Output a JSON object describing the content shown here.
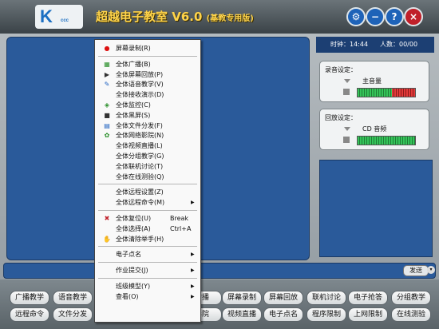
{
  "app": {
    "logo_sub": "ccc",
    "title": "超越电子教室",
    "version": "V6.0",
    "edition": "(基教专用版)"
  },
  "window_buttons": [
    {
      "name": "settings",
      "glyph": "⚙",
      "color": "#1e63b8"
    },
    {
      "name": "minimize",
      "glyph": "−",
      "color": "#1e63b8"
    },
    {
      "name": "help",
      "glyph": "?",
      "color": "#1e63b8"
    },
    {
      "name": "close",
      "glyph": "×",
      "color": "#c0202a"
    }
  ],
  "status": {
    "clock_label": "时钟：",
    "clock_value": "14:44",
    "people_label": "人数：",
    "people_value": "00/00"
  },
  "recording": {
    "label": "录音设定：",
    "source": "主音量",
    "level_green_pct": 0.6,
    "level_red_pct": 0.4
  },
  "playback": {
    "label": "回放设定：",
    "source": "CD 音频",
    "level_green_pct": 1.0
  },
  "chat": {
    "send_label": "发送",
    "send_arrow": "▾"
  },
  "toolbar": {
    "row1": [
      "广播教学",
      "语音教学",
      "",
      "",
      "转播",
      "屏幕录制",
      "屏幕回放",
      "联机讨论",
      "电子抢答",
      "分组教学"
    ],
    "row2": [
      "远程命令",
      "文件分发",
      "",
      "",
      "影院",
      "视频直播",
      "电子点名",
      "程序限制",
      "上网限制",
      "在线测验"
    ]
  },
  "menu": [
    {
      "type": "item",
      "label": "屏幕录制(R)",
      "icon": "●",
      "icon_color": "#d11"
    },
    {
      "type": "sep"
    },
    {
      "type": "item",
      "label": "全体广播(B)",
      "icon": "▦",
      "icon_color": "#2a8f2a"
    },
    {
      "type": "item",
      "label": "全体屏幕回放(P)",
      "icon": "▶",
      "icon_color": "#333"
    },
    {
      "type": "item",
      "label": "全体语音教学(V)",
      "icon": "✎",
      "icon_color": "#1b5fbf"
    },
    {
      "type": "item",
      "label": "全体接收演示(D)",
      "icon": "",
      "icon_color": "#333"
    },
    {
      "type": "item",
      "label": "全体监控(C)",
      "icon": "◈",
      "icon_color": "#2a8f2a"
    },
    {
      "type": "item",
      "label": "全体黑屏(S)",
      "icon": "■",
      "icon_color": "#333"
    },
    {
      "type": "item",
      "label": "全体文件分发(F)",
      "icon": "▤",
      "icon_color": "#1b5fbf"
    },
    {
      "type": "item",
      "label": "全体网络影院(N)",
      "icon": "✿",
      "icon_color": "#2a8f2a"
    },
    {
      "type": "item",
      "label": "全体视频直播(L)",
      "icon": "",
      "icon_color": "#333"
    },
    {
      "type": "item",
      "label": "全体分组教学(G)",
      "icon": "",
      "icon_color": "#333"
    },
    {
      "type": "item",
      "label": "全体联机讨论(T)",
      "icon": "",
      "icon_color": "#333"
    },
    {
      "type": "item",
      "label": "全体在线测验(Q)",
      "icon": "",
      "icon_color": "#333"
    },
    {
      "type": "sep"
    },
    {
      "type": "item",
      "label": "全体远程设置(Z)",
      "icon": "",
      "icon_color": "#333"
    },
    {
      "type": "item",
      "label": "全体远程命令(M)",
      "icon": "",
      "icon_color": "#333",
      "submenu": true
    },
    {
      "type": "sep"
    },
    {
      "type": "item",
      "label": "全体复位(U)",
      "shortcut": "Break",
      "icon": "✖",
      "icon_color": "#c0202a"
    },
    {
      "type": "item",
      "label": "全体选择(A)",
      "shortcut": "Ctrl+A",
      "icon": "",
      "icon_color": "#333"
    },
    {
      "type": "item",
      "label": "全体清除举手(H)",
      "icon": "✋",
      "icon_color": "#1b5fbf"
    },
    {
      "type": "sep"
    },
    {
      "type": "item",
      "label": "电子点名",
      "icon": "",
      "icon_color": "#333",
      "submenu": true
    },
    {
      "type": "sep"
    },
    {
      "type": "item",
      "label": "作业提交(J)",
      "icon": "",
      "icon_color": "#333",
      "submenu": true
    },
    {
      "type": "sep"
    },
    {
      "type": "item",
      "label": "班级模型(Y)",
      "icon": "",
      "icon_color": "#333",
      "submenu": true
    },
    {
      "type": "item",
      "label": "查看(O)",
      "icon": "",
      "icon_color": "#333",
      "submenu": true
    }
  ]
}
